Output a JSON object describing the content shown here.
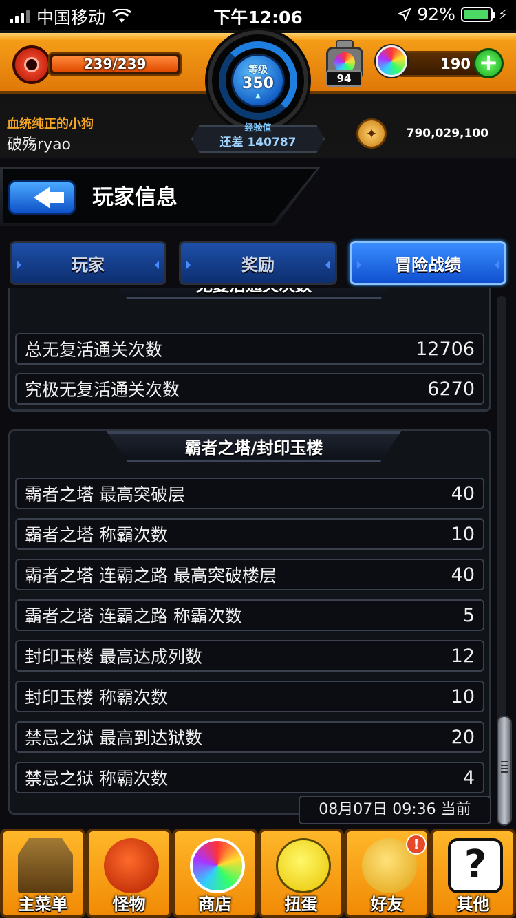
{
  "statusbar": {
    "carrier": "中国移动",
    "time": "下午12:06",
    "battery_percent": "92%",
    "battery_level": 0.92
  },
  "hud": {
    "hp": "239/239",
    "hp_fill": 1.0,
    "level_label": "等级",
    "level": "350",
    "exp_label": "经验值",
    "exp_remaining": "还差 140787",
    "stamina": "94",
    "gems": "190",
    "add_label": "+",
    "player_title": "血统纯正的小狗",
    "player_name": "破殇ryao",
    "gold": "790,029,100"
  },
  "header": {
    "page_title": "玩家信息"
  },
  "tabs": [
    {
      "label": "玩家",
      "active": false
    },
    {
      "label": "奖励",
      "active": false
    },
    {
      "label": "冒险战绩",
      "active": true
    }
  ],
  "sections": [
    {
      "title": "无复活通关次数",
      "rows": [
        {
          "label": "总无复活通关次数",
          "value": "12706"
        },
        {
          "label": "究极无复活通关次数",
          "value": "6270"
        }
      ]
    },
    {
      "title": "霸者之塔/封印玉楼",
      "rows": [
        {
          "label": "霸者之塔 最高突破层",
          "value": "40"
        },
        {
          "label": "霸者之塔 称霸次数",
          "value": "10"
        },
        {
          "label": "霸者之塔 连霸之路 最高突破楼层",
          "value": "40"
        },
        {
          "label": "霸者之塔 连霸之路 称霸次数",
          "value": "5"
        },
        {
          "label": "封印玉楼 最高达成列数",
          "value": "12"
        },
        {
          "label": "封印玉楼 称霸次数",
          "value": "10"
        },
        {
          "label": "禁忌之狱 最高到达狱数",
          "value": "20"
        },
        {
          "label": "禁忌之狱 称霸次数",
          "value": "4"
        }
      ]
    }
  ],
  "timestamp": "08月07日 09:36 当前",
  "bottomnav": [
    {
      "label": "主菜单",
      "icon": "gate-icon"
    },
    {
      "label": "怪物",
      "icon": "monster-icon"
    },
    {
      "label": "商店",
      "icon": "rainbow-orb-icon"
    },
    {
      "label": "扭蛋",
      "icon": "egg-icon"
    },
    {
      "label": "好友",
      "icon": "balloons-icon",
      "badge": "!"
    },
    {
      "label": "其他",
      "icon": "question-icon"
    }
  ]
}
